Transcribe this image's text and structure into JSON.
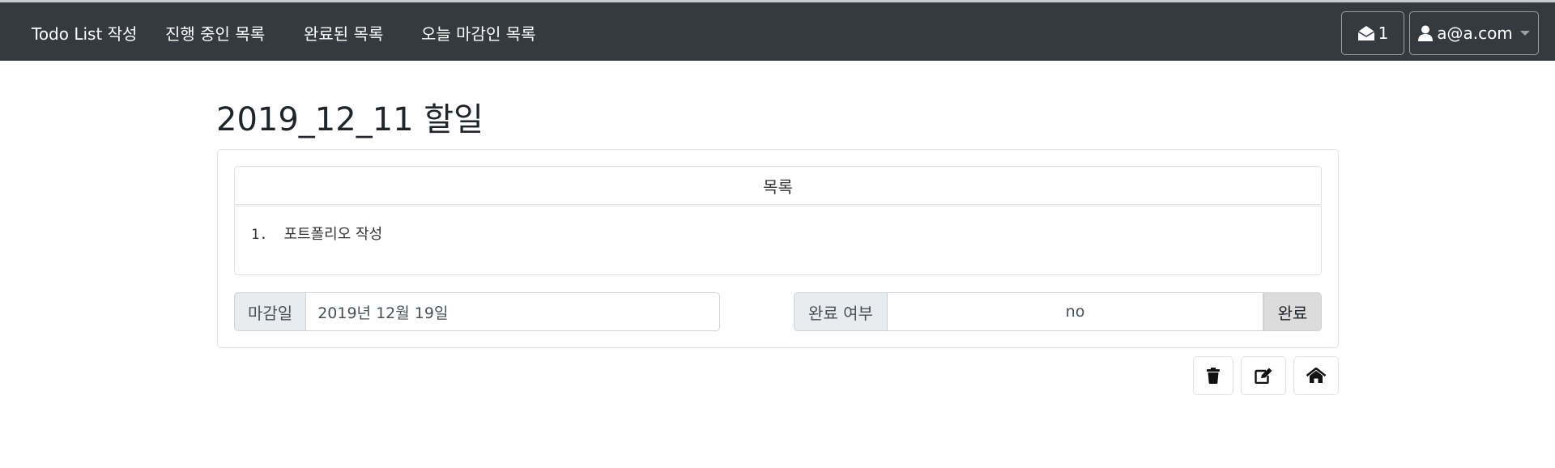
{
  "navbar": {
    "links": [
      "Todo List 작성",
      "진행 중인 목록",
      "완료된 목록",
      "오늘 마감인 목록"
    ],
    "notification_count": "1",
    "user_email": "a@a.com"
  },
  "page": {
    "title": "2019_12_11 할일"
  },
  "todo": {
    "list_header": "목록",
    "items": [
      {
        "number": "1.",
        "text": "포트폴리오 작성"
      }
    ],
    "deadline_label": "마감일",
    "deadline_value": "2019년 12월 19일",
    "status_label": "완료 여부",
    "status_value": "no",
    "complete_button": "완료"
  },
  "actions": {
    "icons": [
      "trash-icon",
      "edit-icon",
      "home-icon"
    ]
  }
}
